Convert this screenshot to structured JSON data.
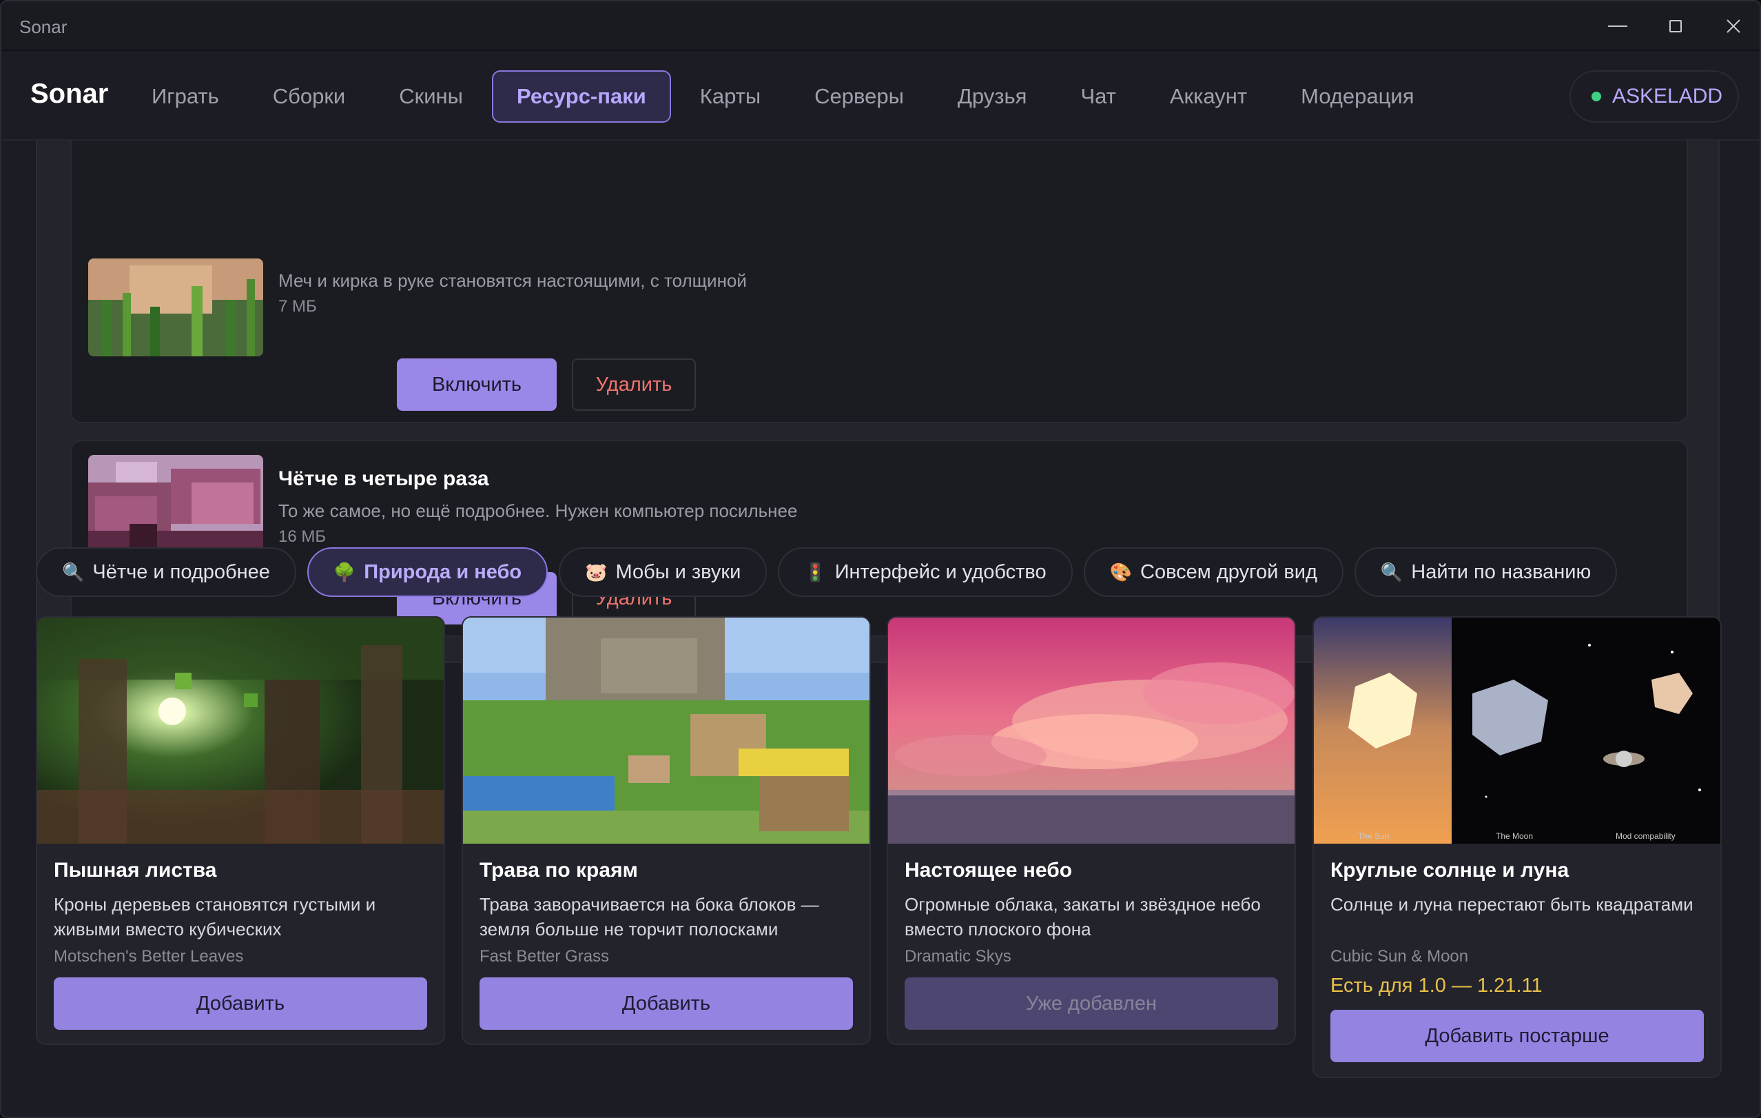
{
  "window": {
    "title": "Sonar"
  },
  "nav": {
    "brand": "Sonar",
    "items": [
      {
        "label": "Играть",
        "active": false
      },
      {
        "label": "Сборки",
        "active": false
      },
      {
        "label": "Скины",
        "active": false
      },
      {
        "label": "Ресурс-паки",
        "active": true
      },
      {
        "label": "Карты",
        "active": false
      },
      {
        "label": "Серверы",
        "active": false
      },
      {
        "label": "Друзья",
        "active": false
      },
      {
        "label": "Чат",
        "active": false
      },
      {
        "label": "Аккаунт",
        "active": false
      },
      {
        "label": "Модерация",
        "active": false
      }
    ],
    "user": {
      "name": "ASKELADD",
      "status_color": "#3fd084"
    }
  },
  "installed": [
    {
      "title": "",
      "description": "Меч и кирка в руке становятся настоящими, с толщиной",
      "size": "7 МБ",
      "enable_label": "Включить",
      "delete_label": "Удалить"
    },
    {
      "title": "Чётче в четыре раза",
      "description": "То же самое, но ещё подробнее. Нужен компьютер посильнее",
      "size": "16 МБ",
      "enable_label": "Включить",
      "delete_label": "Удалить"
    }
  ],
  "tabs": [
    {
      "icon": "🔍",
      "icon_name": "magnifier-icon",
      "label": "Чётче и подробнее",
      "active": false
    },
    {
      "icon": "🌳",
      "icon_name": "tree-icon",
      "label": "Природа и небо",
      "active": true
    },
    {
      "icon": "🐷",
      "icon_name": "pig-icon",
      "label": "Мобы и звуки",
      "active": false
    },
    {
      "icon": "🚦",
      "icon_name": "traffic-light-icon",
      "label": "Интерфейс и удобство",
      "active": false
    },
    {
      "icon": "🎨",
      "icon_name": "palette-icon",
      "label": "Совсем другой вид",
      "active": false
    },
    {
      "icon": "🔍",
      "icon_name": "magnifier-icon",
      "label": "Найти по названию",
      "active": false
    }
  ],
  "cards": [
    {
      "title": "Пышная листва",
      "description": "Кроны деревьев становятся густыми и живыми вместо кубических",
      "source": "Motschen's Better Leaves",
      "compat": "",
      "button": "Добавить",
      "disabled": false
    },
    {
      "title": "Трава по краям",
      "description": "Трава заворачивается на бока блоков — земля больше не торчит полосками",
      "source": "Fast Better Grass",
      "compat": "",
      "button": "Добавить",
      "disabled": false
    },
    {
      "title": "Настоящее небо",
      "description": "Огромные облака, закаты и звёздное небо вместо плоского фона",
      "source": "Dramatic Skys",
      "compat": "",
      "button": "Уже добавлен",
      "disabled": true
    },
    {
      "title": "Круглые солнце и луна",
      "description": "Солнце и луна перестают быть квадратами",
      "source": "Cubic Sun & Moon",
      "compat": "Есть для 1.0 — 1.21.11",
      "button": "Добавить постарше",
      "disabled": false,
      "image_captions": [
        "The Sun",
        "The Moon",
        "Mod compability"
      ]
    }
  ],
  "colors": {
    "accent": "#9a87e8",
    "danger": "#f0736d",
    "warning": "#e8c04a",
    "background": "#1c1d24"
  }
}
